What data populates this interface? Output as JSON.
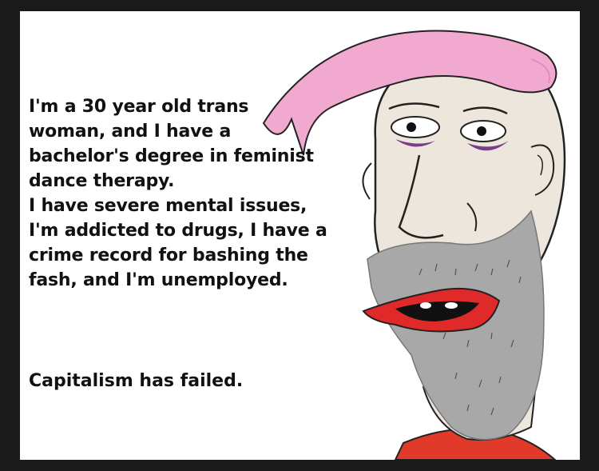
{
  "meme": {
    "lines": [
      "I'm a 30 year old trans",
      "woman, and I have a",
      "bachelor's degree in feminist",
      "dance therapy.",
      "I have severe mental issues,",
      "I'm addicted to drugs, I have a",
      "crime record for bashing the",
      "fash, and I'm unemployed."
    ],
    "closing": "Capitalism has failed."
  },
  "colors": {
    "hair": "#f2a9d0",
    "skin": "#ece6dc",
    "beard": "#a8a8a8",
    "lips": "#e02a2a",
    "eye_bags": "#7a3d8c",
    "shirt": "#e23a2a",
    "frame": "#1a1a1a"
  }
}
